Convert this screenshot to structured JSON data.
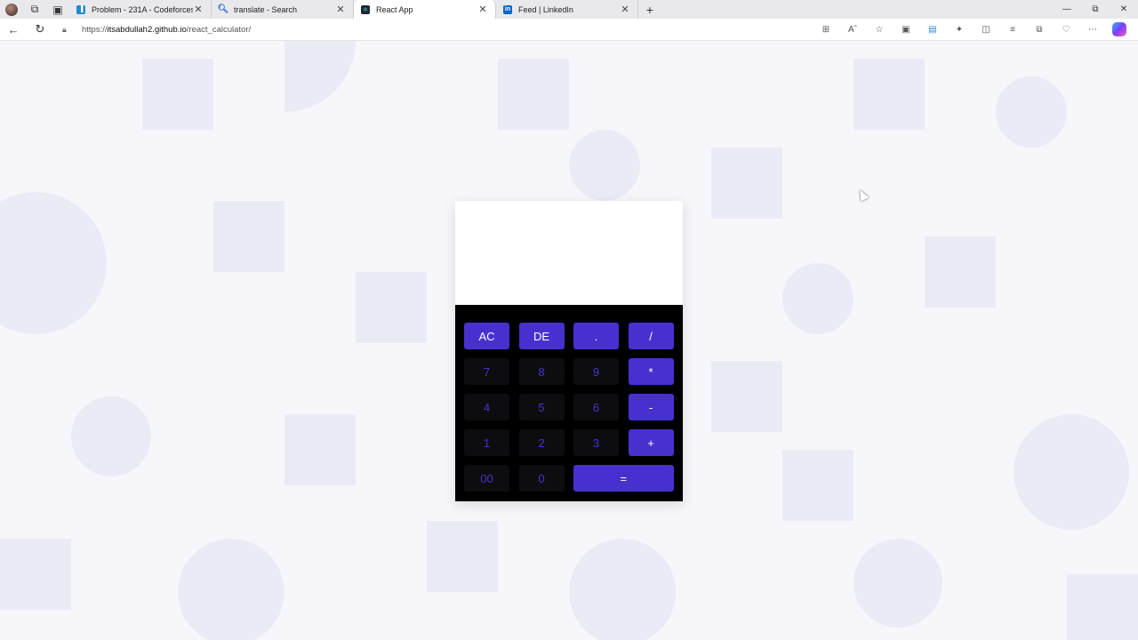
{
  "browser": {
    "tabs": [
      {
        "title": "Problem - 231A - Codeforces",
        "icon": "codeforces-icon",
        "color": "#1f8acb"
      },
      {
        "title": "translate - Search",
        "icon": "search-icon",
        "color": "#2a66d8"
      },
      {
        "title": "React App",
        "icon": "react-icon",
        "color": "#1e2a2e"
      },
      {
        "title": "Feed | LinkedIn",
        "icon": "linkedin-icon",
        "color": "#0a66c2"
      }
    ],
    "active_tab": 2,
    "url_prefix": "https://",
    "url_host": "itsabdullah2.github.io",
    "url_path": "/react_calculator/"
  },
  "calculator": {
    "display": "",
    "accent_color": "#4631cf",
    "rows": [
      [
        {
          "label": "AC",
          "kind": "op"
        },
        {
          "label": "DE",
          "kind": "op"
        },
        {
          "label": ".",
          "kind": "op"
        },
        {
          "label": "/",
          "kind": "op"
        }
      ],
      [
        {
          "label": "7",
          "kind": "num"
        },
        {
          "label": "8",
          "kind": "num"
        },
        {
          "label": "9",
          "kind": "num"
        },
        {
          "label": "*",
          "kind": "op"
        }
      ],
      [
        {
          "label": "4",
          "kind": "num"
        },
        {
          "label": "5",
          "kind": "num"
        },
        {
          "label": "6",
          "kind": "num"
        },
        {
          "label": "-",
          "kind": "op"
        }
      ],
      [
        {
          "label": "1",
          "kind": "num"
        },
        {
          "label": "2",
          "kind": "num"
        },
        {
          "label": "3",
          "kind": "num"
        },
        {
          "label": "+",
          "kind": "op"
        }
      ],
      [
        {
          "label": "00",
          "kind": "num"
        },
        {
          "label": "0",
          "kind": "num"
        },
        {
          "label": "=",
          "kind": "op",
          "wide": true
        }
      ]
    ]
  }
}
